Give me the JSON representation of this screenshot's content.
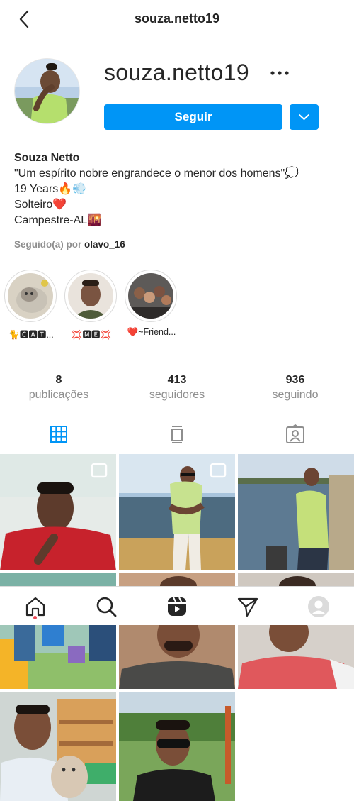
{
  "header": {
    "title": "souza.netto19",
    "back_icon": "chevron-left-icon"
  },
  "profile": {
    "username": "souza.netto19",
    "more_icon": "more-horizontal-icon",
    "follow_label": "Seguir",
    "dropdown_icon": "chevron-down-icon",
    "accent_color": "#0095f6"
  },
  "bio": {
    "name": "Souza Netto",
    "line1": "\"Um espírito nobre engrandece o menor dos homens\"💭",
    "line2": "19 Years🔥💨",
    "line3": "Solteiro❤️",
    "line4": "Campestre-AL🌇"
  },
  "followed_by": {
    "prefix": "Seguido(a) por",
    "user": "olavo_16"
  },
  "highlights": [
    {
      "label": "🐈🅲🅰🆃..."
    },
    {
      "label": "💢🅼🅴💢"
    },
    {
      "label": "❤️~Friend..."
    }
  ],
  "stats": {
    "posts_count": "8",
    "posts_label": "publicações",
    "followers_count": "413",
    "followers_label": "seguidores",
    "following_count": "936",
    "following_label": "seguindo"
  },
  "tabs": {
    "grid_icon": "grid-icon",
    "feed_icon": "feed-icon",
    "tagged_icon": "tagged-person-icon",
    "active_color": "#0095f6"
  },
  "bottom_nav": {
    "home_icon": "home-icon",
    "search_icon": "search-icon",
    "reels_icon": "reels-icon",
    "direct_icon": "direct-send-icon",
    "profile_icon": "profile-avatar-icon",
    "notification_dot_color": "#ed4956"
  }
}
